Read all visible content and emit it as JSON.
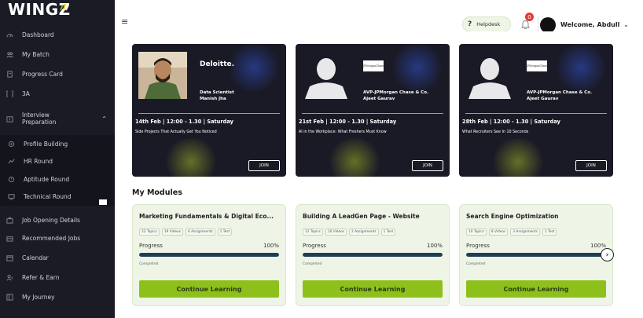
{
  "app": {
    "logo_text": "WINGZ"
  },
  "sidebar": {
    "items": [
      {
        "label": "Dashboard",
        "icon": "dashboard-icon"
      },
      {
        "label": "My Batch",
        "icon": "batch-icon"
      },
      {
        "label": "Progress Card",
        "icon": "progress-card-icon"
      },
      {
        "label": "3A",
        "icon": "3a-icon"
      },
      {
        "label": "Interview",
        "label2": "Preparation",
        "icon": "interview-icon",
        "expanded": true
      },
      {
        "label": "Profile Building",
        "icon": "profile-icon"
      },
      {
        "label": "HR Round",
        "icon": "hr-icon"
      },
      {
        "label": "Aptitude Round",
        "icon": "aptitude-icon"
      },
      {
        "label": "Technical Round",
        "icon": "technical-icon"
      },
      {
        "label": "Job Opening Details",
        "icon": "job-icon"
      },
      {
        "label": "Recommended Jobs",
        "icon": "recommended-icon"
      },
      {
        "label": "Calendar",
        "icon": "calendar-icon"
      },
      {
        "label": "Refer & Earn",
        "icon": "refer-icon"
      },
      {
        "label": "My Journey",
        "icon": "journey-icon"
      }
    ]
  },
  "header": {
    "menu_icon": "≡",
    "helpdesk_label": "Helpdesk",
    "helpdesk_icon": "?",
    "notification_count": "0",
    "welcome_text": "Welcome, Abdull",
    "caret": "⌄"
  },
  "events": [
    {
      "brand": "Deloitte.",
      "role_line1": "Data Scientist",
      "role_line2": "Manish Jha",
      "date": "14th Feb | 12:00 - 1.30 | Saturday",
      "topic": "Side Projects That Actually Get You Noticed",
      "join_label": "JOIN"
    },
    {
      "brand": "JPMorganChase",
      "role_line1": "AVP-JPMorgan Chase & Co.",
      "role_line2": "Ajeet Gaurav",
      "date": "21st Feb | 12:00 - 1.30 | Saturday",
      "topic": "AI in the Workplace: What Freshers Must Know",
      "join_label": "JOIN"
    },
    {
      "brand": "JPMorganChase",
      "role_line1": "AVP-JPMorgan Chase & Co.",
      "role_line2": "Ajeet Gaurav",
      "date": "28th Feb | 12:00 - 1.30 | Saturday",
      "topic": "What Recruiters See In 10 Seconds",
      "join_label": "JOIN"
    }
  ],
  "modules_title": "My Modules",
  "modules": [
    {
      "title": "Marketing Fundamentals & Digital Eco...",
      "tags": [
        "22 Topics",
        "19 Videos",
        "4 Assignments",
        "1 Test"
      ],
      "progress_label": "Progress",
      "progress_pct": "100%",
      "progress_value": 1.0,
      "status": "Completed",
      "button": "Continue Learning"
    },
    {
      "title": "Building A LeadGen Page - Website",
      "tags": [
        "12 Topics",
        "10 Videos",
        "2 Assignments",
        "1 Test"
      ],
      "progress_label": "Progress",
      "progress_pct": "100%",
      "progress_value": 1.0,
      "status": "Completed",
      "button": "Continue Learning"
    },
    {
      "title": "Search Engine Optimization",
      "tags": [
        "10 Topics",
        "8 Videos",
        "3 Assignments",
        "1 Test"
      ],
      "progress_label": "Progress",
      "progress_pct": "100%",
      "progress_value": 1.0,
      "status": "Completed",
      "button": "Continue Learning"
    }
  ],
  "colors": {
    "sidebar_bg": "#1b1b25",
    "event_bg": "#1a1a26",
    "module_bg": "#eef5e6",
    "accent_green": "#8ec01c",
    "progress_fill": "#1e3f57",
    "badge_red": "#e53935"
  }
}
